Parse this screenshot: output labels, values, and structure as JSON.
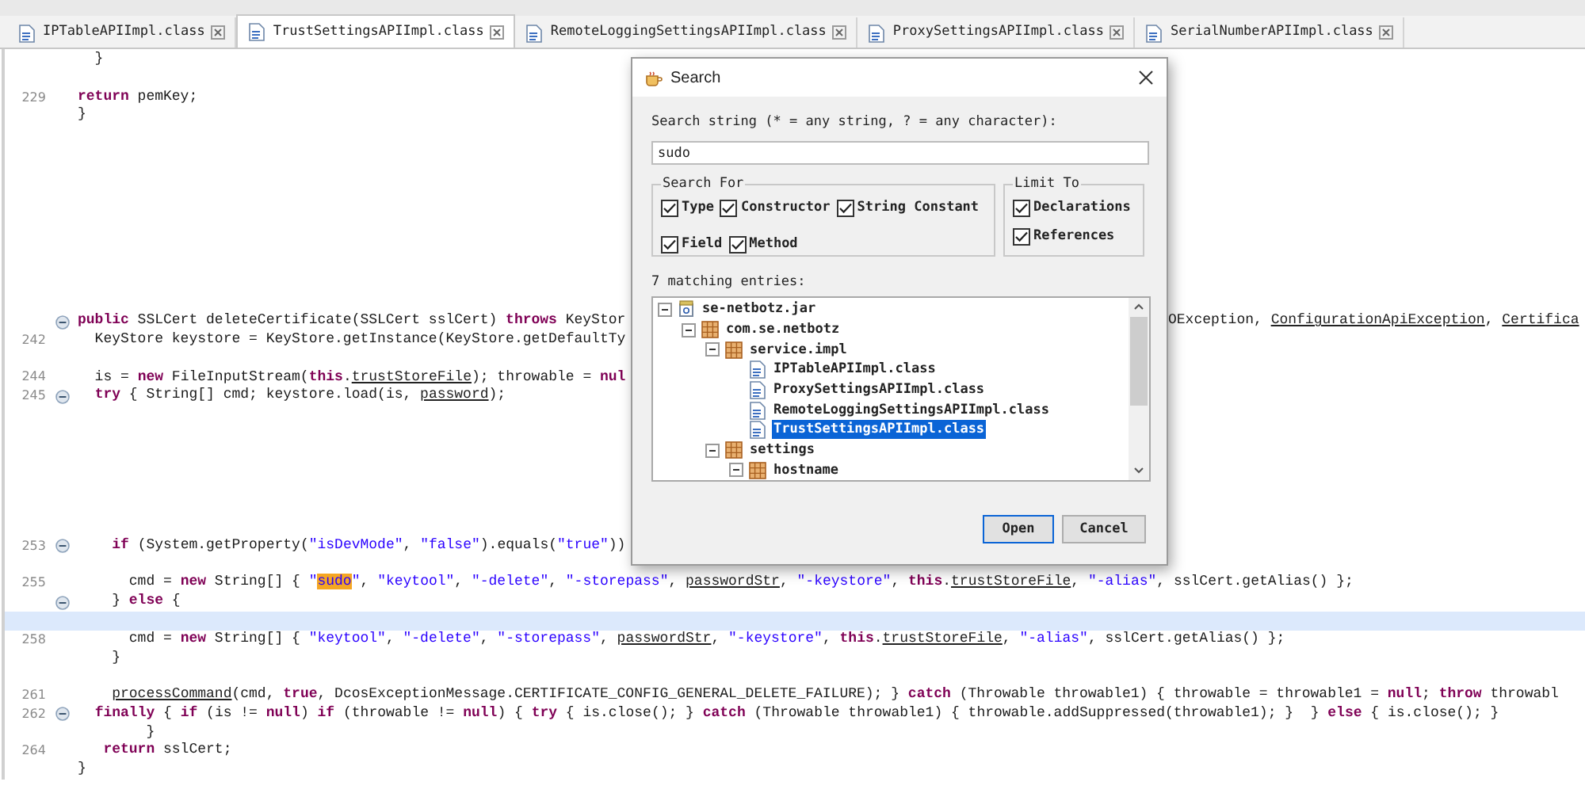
{
  "tabs": [
    {
      "label": "IPTableAPIImpl.class",
      "selected": false
    },
    {
      "label": "TrustSettingsAPIImpl.class",
      "selected": true
    },
    {
      "label": "RemoteLoggingSettingsAPIImpl.class",
      "selected": false
    },
    {
      "label": "ProxySettingsAPIImpl.class",
      "selected": false
    },
    {
      "label": "SerialNumberAPIImpl.class",
      "selected": false
    }
  ],
  "editor": {
    "lines": [
      {
        "fold": false,
        "current": false,
        "code": [
          "  }"
        ]
      },
      {
        "fold": false,
        "current": false
      },
      {
        "number": "229",
        "fold": false,
        "current": false,
        "code": [
          {
            "kind": "keyword",
            "text": "return"
          },
          " pemKey;"
        ]
      },
      {
        "fold": false,
        "current": false,
        "code": [
          "}"
        ]
      },
      {
        "fold": false,
        "current": false
      },
      {
        "fold": false,
        "current": false
      },
      {
        "fold": false,
        "current": false
      },
      {
        "fold": false,
        "current": false
      },
      {
        "fold": false,
        "current": false
      },
      {
        "fold": false,
        "current": false
      },
      {
        "fold": false,
        "current": false
      },
      {
        "fold": false,
        "current": false
      },
      {
        "fold": false,
        "current": false
      },
      {
        "fold": false,
        "current": false
      },
      {
        "fold": true,
        "current": false,
        "code": [
          {
            "kind": "keyword",
            "text": "public"
          },
          " SSLCert deleteCertificate(SSLCert sslCert) ",
          {
            "kind": "keyword",
            "text": "throws"
          },
          " KeyStor"
        ],
        "code_right": [
          "OException, ",
          {
            "kind": "link",
            "text": "ConfigurationApiException"
          },
          ", ",
          {
            "kind": "link",
            "text": "Certifica"
          }
        ]
      },
      {
        "number": "242",
        "fold": false,
        "current": false,
        "code": [
          "  KeyStore keystore = KeyStore.getInstance(KeyStore.getDefaultTy"
        ]
      },
      {
        "fold": false,
        "current": false
      },
      {
        "number": "244",
        "fold": false,
        "current": false,
        "code": [
          "  is = ",
          {
            "kind": "keyword",
            "text": "new"
          },
          " FileInputStream(",
          {
            "kind": "keyword",
            "text": "this"
          },
          ".",
          {
            "kind": "link",
            "text": "trustStoreFile"
          },
          "); throwable = ",
          {
            "kind": "keyword",
            "text": "nul"
          }
        ]
      },
      {
        "number": "245",
        "fold": true,
        "current": false,
        "code": [
          {
            "kind": "keyword",
            "text": "  try"
          },
          " { String[] cmd; keystore.load(is, ",
          {
            "kind": "link",
            "text": "password"
          },
          ");"
        ]
      },
      {
        "fold": false,
        "current": false
      },
      {
        "fold": false,
        "current": false
      },
      {
        "fold": false,
        "current": false
      },
      {
        "fold": false,
        "current": false
      },
      {
        "fold": false,
        "current": false
      },
      {
        "fold": false,
        "current": false
      },
      {
        "fold": false,
        "current": false
      },
      {
        "number": "253",
        "fold": true,
        "current": false,
        "code": [
          {
            "kind": "keyword",
            "text": "    if"
          },
          " (System.getProperty(",
          {
            "kind": "string",
            "text": "\"isDevMode\""
          },
          ", ",
          {
            "kind": "string",
            "text": "\"false\""
          },
          ").equals(",
          {
            "kind": "string",
            "text": "\"true\""
          },
          "))"
        ]
      },
      {
        "fold": false,
        "current": false
      },
      {
        "number": "255",
        "fold": false,
        "current": false,
        "code": [
          "      cmd = ",
          {
            "kind": "keyword",
            "text": "new"
          },
          " String[] { ",
          {
            "kind": "string",
            "text": "\""
          },
          {
            "kind": "match",
            "text": "sudo"
          },
          {
            "kind": "string",
            "text": "\""
          },
          ", ",
          {
            "kind": "string",
            "text": "\"keytool\""
          },
          ", ",
          {
            "kind": "string",
            "text": "\"-delete\""
          },
          ", ",
          {
            "kind": "string",
            "text": "\"-storepass\""
          },
          ", ",
          {
            "kind": "link",
            "text": "passwordStr"
          },
          ", ",
          {
            "kind": "string",
            "text": "\"-keystore\""
          },
          ", ",
          {
            "kind": "keyword",
            "text": "this"
          },
          ".",
          {
            "kind": "link",
            "text": "trustStoreFile"
          },
          ", ",
          {
            "kind": "string",
            "text": "\"-alias\""
          },
          ", sslCert.getAlias() };"
        ]
      },
      {
        "fold": true,
        "current": false,
        "code": [
          "    } ",
          {
            "kind": "keyword",
            "text": "else"
          },
          " {"
        ]
      },
      {
        "fold": false,
        "current": true
      },
      {
        "number": "258",
        "fold": false,
        "current": false,
        "code": [
          "      cmd = ",
          {
            "kind": "keyword",
            "text": "new"
          },
          " String[] { ",
          {
            "kind": "string",
            "text": "\"keytool\""
          },
          ", ",
          {
            "kind": "string",
            "text": "\"-delete\""
          },
          ", ",
          {
            "kind": "string",
            "text": "\"-storepass\""
          },
          ", ",
          {
            "kind": "link",
            "text": "passwordStr"
          },
          ", ",
          {
            "kind": "string",
            "text": "\"-keystore\""
          },
          ", ",
          {
            "kind": "keyword",
            "text": "this"
          },
          ".",
          {
            "kind": "link",
            "text": "trustStoreFile"
          },
          ", ",
          {
            "kind": "string",
            "text": "\"-alias\""
          },
          ", sslCert.getAlias() };"
        ]
      },
      {
        "fold": false,
        "current": false,
        "code": [
          "    }"
        ]
      },
      {
        "fold": false,
        "current": false
      },
      {
        "number": "261",
        "fold": false,
        "current": false,
        "code": [
          {
            "kind": "link",
            "text": "    processCommand"
          },
          "(cmd, ",
          {
            "kind": "keyword",
            "text": "true"
          },
          ", DcosExceptionMessage.CERTIFICATE_CONFIG_GENERAL_DELETE_FAILURE); } ",
          {
            "kind": "keyword",
            "text": "catch"
          },
          " (Throwable throwable1) { throwable = throwable1 = ",
          {
            "kind": "keyword",
            "text": "null"
          },
          "; ",
          {
            "kind": "keyword",
            "text": "throw"
          },
          " throwabl"
        ]
      },
      {
        "number": "262",
        "fold": true,
        "current": false,
        "code": [
          {
            "kind": "keyword",
            "text": "  finally"
          },
          " { ",
          {
            "kind": "keyword",
            "text": "if"
          },
          " (is != ",
          {
            "kind": "keyword",
            "text": "null"
          },
          ") ",
          {
            "kind": "keyword",
            "text": "if"
          },
          " (throwable != ",
          {
            "kind": "keyword",
            "text": "null"
          },
          ") { ",
          {
            "kind": "keyword",
            "text": "try"
          },
          " { is.close(); } ",
          {
            "kind": "keyword",
            "text": "catch"
          },
          " (Throwable throwable1) { throwable.addSuppressed(throwable1); }  } ",
          {
            "kind": "keyword",
            "text": "else"
          },
          " { is.close(); }"
        ]
      },
      {
        "fold": false,
        "current": false,
        "code": [
          "        }"
        ]
      },
      {
        "number": "264",
        "fold": false,
        "current": false,
        "code": [
          {
            "kind": "keyword",
            "text": "   return"
          },
          " sslCert;"
        ]
      },
      {
        "fold": false,
        "current": false,
        "code": [
          "}"
        ]
      }
    ]
  },
  "dialog": {
    "title": "Search",
    "prompt": "Search string (* = any string, ? = any character):",
    "search_value": "sudo",
    "search_for": {
      "title": "Search For",
      "options": [
        {
          "label": "Type",
          "checked": true
        },
        {
          "label": "Constructor",
          "checked": true
        },
        {
          "label": "String Constant",
          "checked": true
        },
        {
          "label": "Field",
          "checked": true
        },
        {
          "label": "Method",
          "checked": true
        }
      ]
    },
    "limit_to": {
      "title": "Limit To",
      "options": [
        {
          "label": "Declarations",
          "checked": true
        },
        {
          "label": "References",
          "checked": true
        }
      ]
    },
    "matches_label": "7 matching entries:",
    "tree": [
      {
        "label": "se-netbotz.jar",
        "kind": "jar",
        "expanded": true,
        "selected": false,
        "children": [
          {
            "label": "com.se.netbotz",
            "kind": "package",
            "expanded": true,
            "selected": false,
            "children": [
              {
                "label": "service.impl",
                "kind": "package",
                "expanded": true,
                "selected": false,
                "children": [
                  {
                    "label": "IPTableAPIImpl.class",
                    "kind": "class",
                    "selected": false
                  },
                  {
                    "label": "ProxySettingsAPIImpl.class",
                    "kind": "class",
                    "selected": false
                  },
                  {
                    "label": "RemoteLoggingSettingsAPIImpl.class",
                    "kind": "class",
                    "selected": false
                  },
                  {
                    "label": "TrustSettingsAPIImpl.class",
                    "kind": "class",
                    "selected": true
                  }
                ]
              },
              {
                "label": "settings",
                "kind": "package",
                "expanded": true,
                "selected": false,
                "children": [
                  {
                    "label": "hostname",
                    "kind": "package",
                    "expanded": true,
                    "selected": false
                  }
                ]
              }
            ]
          }
        ]
      }
    ],
    "buttons": [
      {
        "label": "Open",
        "default": true
      },
      {
        "label": "Cancel",
        "default": false
      }
    ]
  }
}
